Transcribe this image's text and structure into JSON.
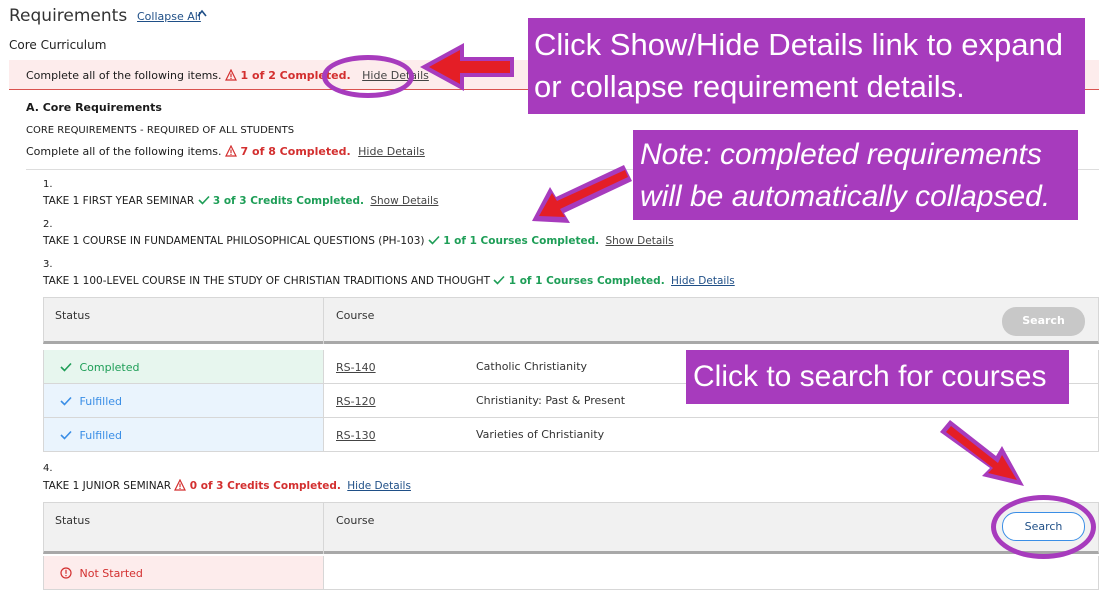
{
  "header": {
    "title": "Requirements",
    "collapse_all": "Collapse All",
    "collapse_icon": "chevron-up-icon",
    "program": "Core Curriculum"
  },
  "banner": {
    "text": "Complete all of the following items.",
    "status": "1 of 2 Completed.",
    "toggle": "Hide Details"
  },
  "section_a": {
    "title": "A. Core Requirements",
    "subtitle": "CORE REQUIREMENTS - REQUIRED OF ALL STUDENTS",
    "text": "Complete all of the following items.",
    "status": "7 of 8 Completed.",
    "toggle": "Hide Details"
  },
  "requirements": [
    {
      "number": "1.",
      "label": "TAKE 1 FIRST YEAR SEMINAR",
      "status": "3 of 3 Credits Completed.",
      "toggle": "Show Details"
    },
    {
      "number": "2.",
      "label": "TAKE 1 COURSE IN FUNDAMENTAL PHILOSOPHICAL QUESTIONS (PH-103)",
      "status": "1 of 1 Courses Completed.",
      "toggle": "Show Details"
    },
    {
      "number": "3.",
      "label": "TAKE 1 100-LEVEL COURSE IN THE STUDY OF CHRISTIAN TRADITIONS AND THOUGHT",
      "status": "1 of 1 Courses Completed.",
      "toggle": "Hide Details"
    },
    {
      "number": "4.",
      "label": "TAKE 1 JUNIOR SEMINAR",
      "status": "0 of 3 Credits Completed.",
      "toggle": "Hide Details"
    }
  ],
  "table3": {
    "col_status": "Status",
    "col_course": "Course",
    "search_label": "Search",
    "rows": [
      {
        "status": "Completed",
        "code": "RS-140",
        "name": "Catholic Christianity"
      },
      {
        "status": "Fulfilled",
        "code": "RS-120",
        "name": "Christianity: Past & Present"
      },
      {
        "status": "Fulfilled",
        "code": "RS-130",
        "name": "Varieties of Christianity"
      }
    ]
  },
  "table4": {
    "col_status": "Status",
    "col_course": "Course",
    "search_label": "Search",
    "rows": [
      {
        "status": "Not Started"
      }
    ]
  },
  "callouts": {
    "show_hide_line1": "Click Show/Hide Details link to expand",
    "show_hide_line2": "or collapse requirement details.",
    "note_line1": "Note: completed requirements",
    "note_line2": "will be automatically collapsed.",
    "search": "Click to search for courses"
  },
  "colors": {
    "accent_purple": "#a73bbd",
    "arrow_red": "#e41e26",
    "error_red": "#d32f2f",
    "success_green": "#1e9e57",
    "fulfilled_blue": "#3a8ee6",
    "link_blue": "#1f4f87"
  }
}
